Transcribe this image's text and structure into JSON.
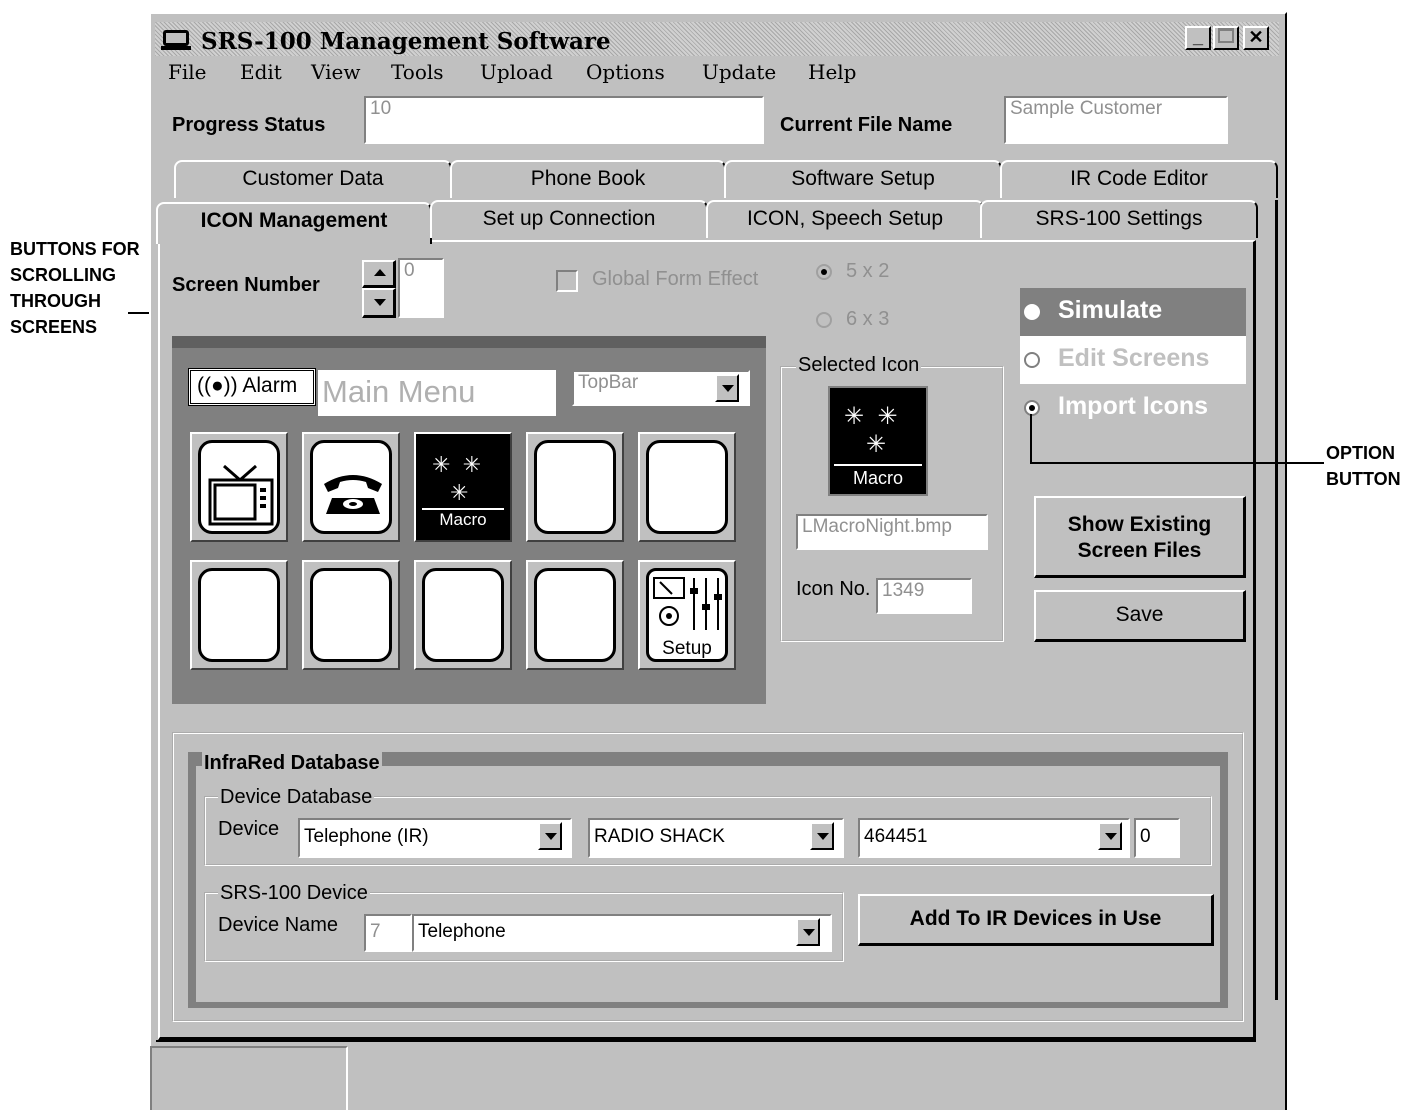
{
  "window": {
    "title": "SRS-100 Management Software"
  },
  "menu": [
    "File",
    "Edit",
    "View",
    "Tools",
    "Upload",
    "Options",
    "Update",
    "Help"
  ],
  "status": {
    "progress_label": "Progress Status",
    "progress_value": "10",
    "file_label": "Current  File Name",
    "file_value": "Sample Customer"
  },
  "tabs_back": [
    "Customer Data",
    "Phone Book",
    "Software Setup",
    "IR Code Editor"
  ],
  "tabs_front": [
    "ICON Management",
    "Set up  Connection",
    "ICON, Speech Setup",
    "SRS-100 Settings"
  ],
  "screen_number": {
    "label": "Screen Number",
    "value": "0"
  },
  "global_form_effect": "Global Form Effect",
  "layout_options": [
    "5 x 2",
    "6 x 3"
  ],
  "mode_options": {
    "simulate": "Simulate",
    "edit": "Edit Screens",
    "import": "Import Icons"
  },
  "preview": {
    "alarm": "Alarm",
    "title": "Main Menu",
    "topbar": "TopBar",
    "macro_label": "Macro",
    "setup_label": "Setup"
  },
  "selected_icon": {
    "label": "Selected Icon",
    "macro_label": "Macro",
    "file": "LMacroNight.bmp",
    "icon_no_label": "Icon No.",
    "icon_no": "1349"
  },
  "buttons": {
    "show_existing": "Show Existing Screen Files",
    "save": "Save",
    "add_ir": "Add To IR Devices in Use"
  },
  "ir_db": {
    "title": "InfraRed Database",
    "device_db_label": "Device Database",
    "device_label": "Device",
    "device": "Telephone (IR)",
    "brand": "RADIO SHACK",
    "code": "464451",
    "index": "0",
    "srs_device_label": "SRS-100 Device",
    "device_name_label": "Device Name",
    "device_num": "7",
    "device_name": "Telephone"
  },
  "annotations": {
    "left": "BUTTONS FOR SCROLLING THROUGH SCREENS",
    "right": "OPTION BUTTON"
  }
}
